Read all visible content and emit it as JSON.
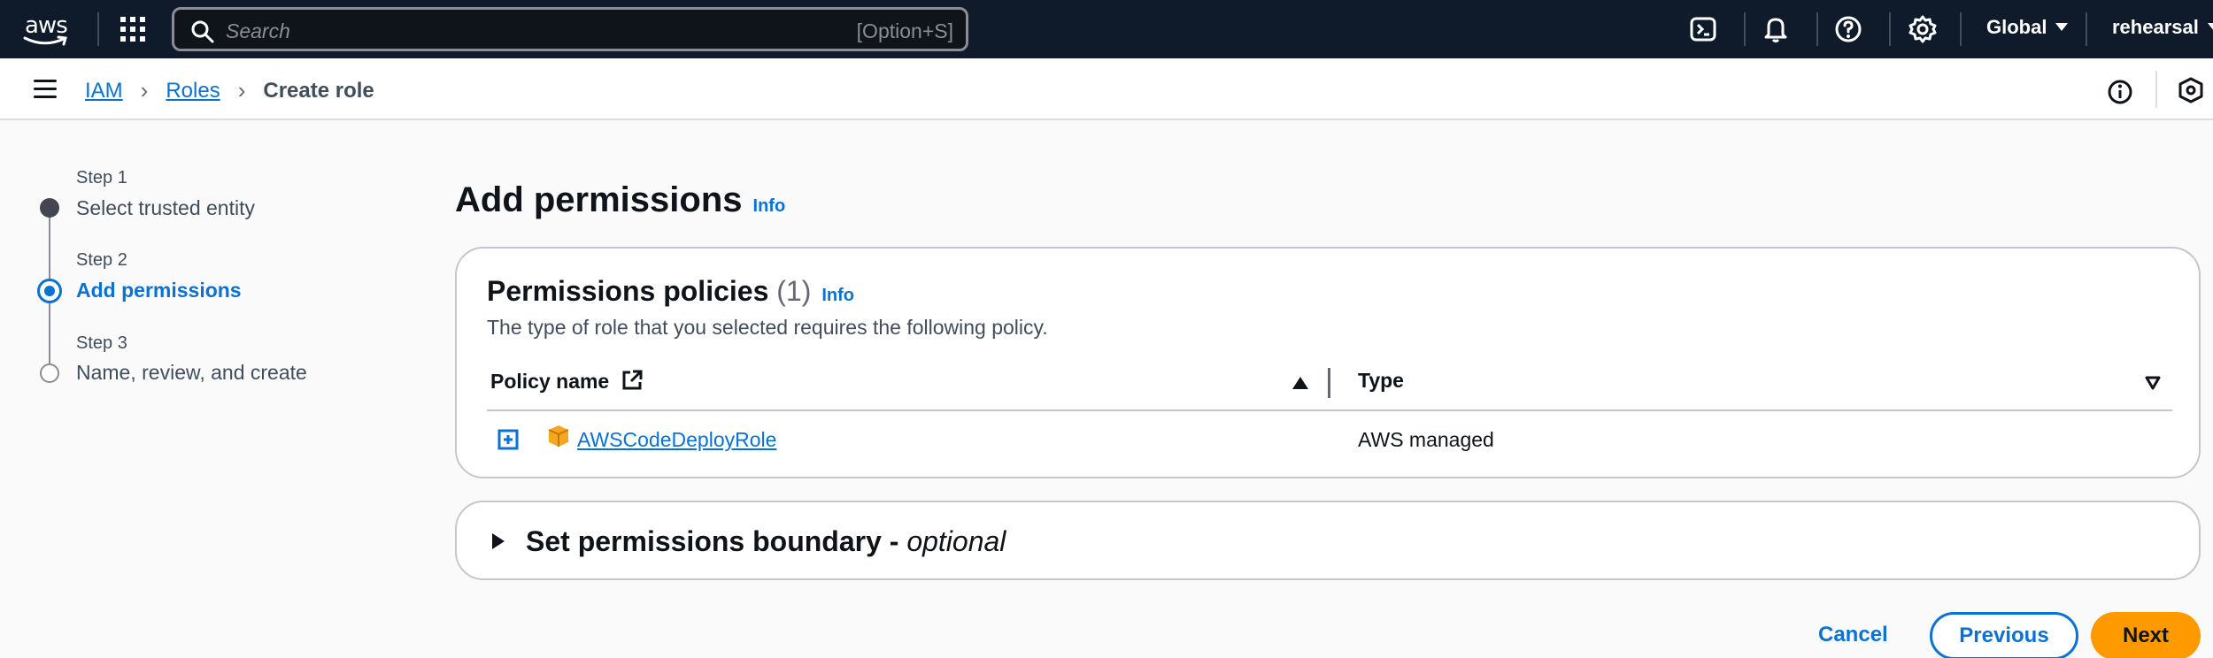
{
  "topnav": {
    "logo_text": "aws",
    "search_placeholder": "Search",
    "search_shortcut": "[Option+S]",
    "region": "Global",
    "account": "rehearsal",
    "icons": [
      "apps-grid-icon",
      "search-icon",
      "cloudshell-icon",
      "bell-icon",
      "help-icon",
      "gear-icon"
    ]
  },
  "breadcrumb": {
    "items": [
      "IAM",
      "Roles",
      "Create role"
    ]
  },
  "steps": [
    {
      "step": "Step 1",
      "label": "Select trusted entity",
      "state": "completed"
    },
    {
      "step": "Step 2",
      "label": "Add permissions",
      "state": "active"
    },
    {
      "step": "Step 3",
      "label": "Name, review, and create",
      "state": "pending"
    }
  ],
  "page": {
    "title": "Add permissions",
    "info": "Info"
  },
  "policies_panel": {
    "title": "Permissions policies",
    "count": "(1)",
    "info": "Info",
    "description": "The type of role that you selected requires the following policy.",
    "columns": {
      "policy_name": "Policy name",
      "type": "Type"
    },
    "rows": [
      {
        "name": "AWSCodeDeployRole",
        "type": "AWS managed"
      }
    ]
  },
  "boundary_panel": {
    "title": "Set permissions boundary - ",
    "optional": "optional"
  },
  "footer": {
    "cancel": "Cancel",
    "previous": "Previous",
    "next": "Next"
  },
  "colors": {
    "nav_bg": "#0f1b2a",
    "link": "#0972d3",
    "primary_button": "#ff9900"
  }
}
